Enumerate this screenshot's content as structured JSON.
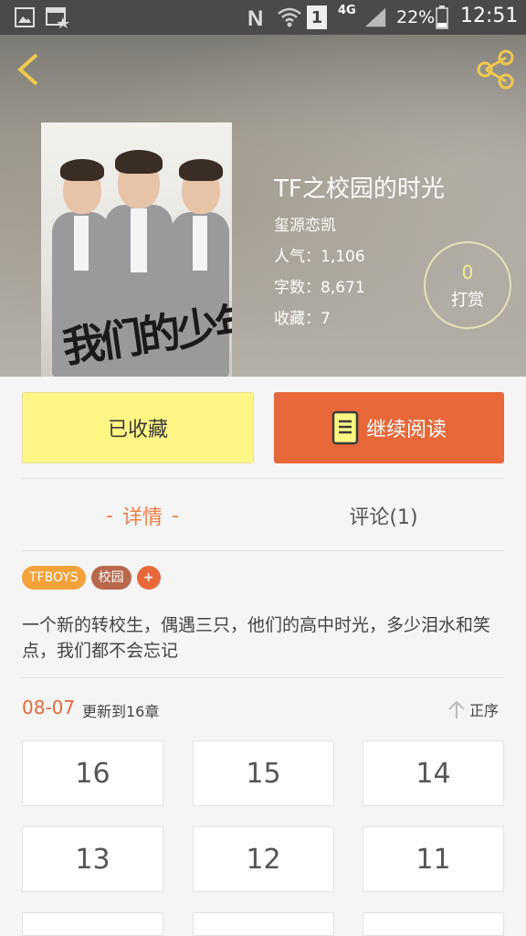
{
  "status_bar": {
    "icons": [
      "image-icon",
      "calendar-star-icon",
      "nfc-icon",
      "wifi-icon",
      "sim-icon",
      "signal-icon",
      "battery-icon"
    ],
    "sim_label": "1",
    "network": "4G",
    "battery": "22%",
    "time": "12:51"
  },
  "header": {
    "back_icon": "chevron-left-icon",
    "share_icon": "share-icon",
    "accent_color": "#f2c94c"
  },
  "book": {
    "title": "TF之校园的时光",
    "author": "玺源恋凯",
    "popularity_label": "人气：",
    "popularity": "1,106",
    "words_label": "字数：",
    "words": "8,671",
    "favorites_label": "收藏：",
    "favorites": "7",
    "cover_title": "我们的少年时代"
  },
  "tip": {
    "count": "0",
    "label": "打赏"
  },
  "actions": {
    "favorited_label": "已收藏",
    "continue_label": "继续阅读"
  },
  "tabs": {
    "detail_dash": "-",
    "detail_label": "详情",
    "comment_label": "评论(1)"
  },
  "tags": {
    "items": [
      "TFBOYS",
      "校园"
    ],
    "add_label": "+"
  },
  "description": "一个新的转校生，偶遇三只，他们的高中时光，多少泪水和笑点，我们都不会忘记",
  "update": {
    "date": "08-07",
    "text": "更新到16章",
    "sort_label": "正序"
  },
  "chapters": [
    "16",
    "15",
    "14",
    "13",
    "12",
    "11"
  ],
  "colors": {
    "orange": "#e8683a",
    "yellow_button": "#fdf684",
    "tag_orange": "#f4a23a",
    "tag_brown": "#b8684c"
  }
}
